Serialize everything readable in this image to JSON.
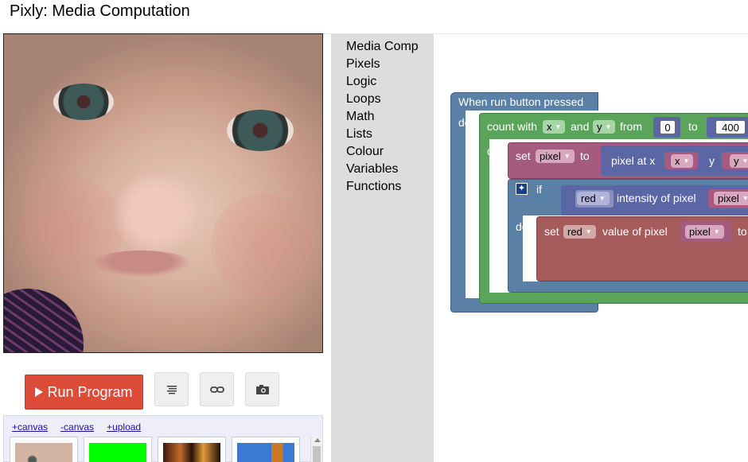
{
  "app": {
    "title": "Pixly: Media Computation"
  },
  "toolbar": {
    "run_label": "Run Program",
    "code_icon": "code-lines-icon",
    "link_icon": "link-icon",
    "camera_icon": "camera-icon"
  },
  "gallery": {
    "links": [
      "+canvas",
      "-canvas",
      "+upload"
    ]
  },
  "toolbox": {
    "categories": [
      "Media Comp",
      "Pixels",
      "Logic",
      "Loops",
      "Math",
      "Lists",
      "Colour",
      "Variables",
      "Functions"
    ]
  },
  "blocks": {
    "event_label": "When run button pressed",
    "do_label": "do",
    "count_with": "count with",
    "var_x": "x",
    "and": "and",
    "var_y": "y",
    "from": "from",
    "from_value": "0",
    "to": "to",
    "to_value": "400",
    "loop_do": "do",
    "set": "set",
    "var_pixel": "pixel",
    "set_to": "to",
    "pixel_at_x": "pixel at x",
    "arg_x": "x",
    "y": "y",
    "arg_y": "y",
    "if": "if",
    "red": "red",
    "intensity_of_pixel": "intensity of pixel",
    "arg_pixel": "pixel",
    "if_do": "do",
    "set2": "set",
    "red2": "red",
    "value_of_pixel": "value of pixel",
    "arg_pixel2": "pixel",
    "to2": "to"
  },
  "colors": {
    "event": "#5b80a5",
    "loop": "#5ba55b",
    "variable": "#a55b80",
    "logic": "#5b80a5",
    "pixel": "#a55b5b",
    "math": "#5b67a5",
    "run_button": "#dd4b39"
  }
}
